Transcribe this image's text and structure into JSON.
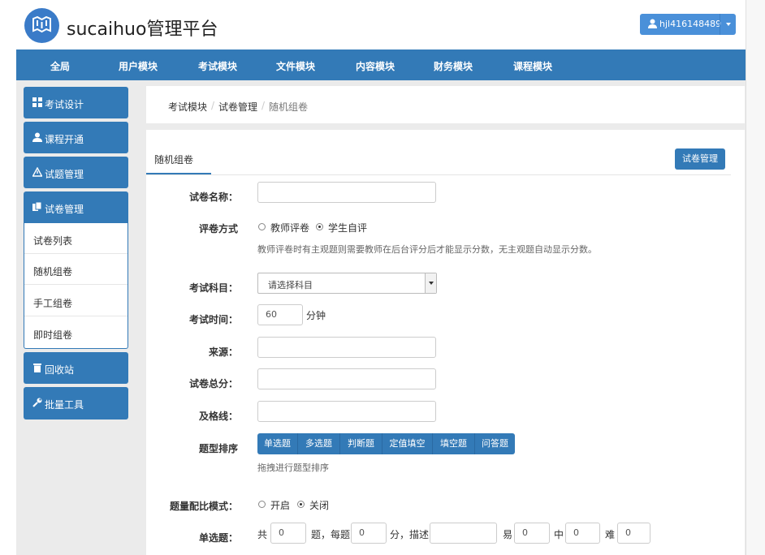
{
  "header": {
    "brand": "sucaihuo管理平台",
    "user": "hjl416148489"
  },
  "topnav": [
    "全局",
    "用户模块",
    "考试模块",
    "文件模块",
    "内容模块",
    "财务模块",
    "课程模块"
  ],
  "sidebar": {
    "exam_design": "考试设计",
    "course_open": "课程开通",
    "question_mgmt": "试题管理",
    "paper_mgmt": "试卷管理",
    "sub_items": [
      "试卷列表",
      "随机组卷",
      "手工组卷",
      "即时组卷"
    ],
    "recycle": "回收站",
    "batch_tools": "批量工具"
  },
  "breadcrumb": [
    "考试模块",
    "试卷管理",
    "随机组卷"
  ],
  "panel": {
    "tab": "随机组卷",
    "paper_mgmt_button": "试卷管理",
    "form": {
      "paper_name_label": "试卷名称：",
      "grading_label": "评卷方式",
      "grading_options": [
        "教师评卷",
        "学生自评"
      ],
      "grading_selected": "学生自评",
      "grading_hint": "教师评卷时有主观题则需要教师在后台评分后才能显示分数，无主观题自动显示分数。",
      "subject_label": "考试科目：",
      "subject_placeholder": "请选择科目",
      "time_label": "考试时间：",
      "time_value": "60",
      "time_unit": "分钟",
      "source_label": "来源：",
      "total_label": "试卷总分：",
      "pass_label": "及格线：",
      "qorder_label": "题型排序",
      "qtypes": [
        "单选题",
        "多选题",
        "判断题",
        "定值填空",
        "填空题",
        "问答题"
      ],
      "qorder_hint": "拖拽进行题型排序",
      "ratio_label": "题量配比模式：",
      "ratio_options": [
        "开启",
        "关闭"
      ],
      "ratio_selected": "关闭",
      "single_label": "单选题：",
      "single_total_prefix": "共",
      "single_count": "0",
      "single_mid": "题，每题",
      "single_score": "0",
      "single_desc": "分，描述",
      "easy_label": "易",
      "easy_val": "0",
      "mid_label": "中",
      "mid_val": "0",
      "hard_label": "难",
      "hard_val": "0"
    }
  },
  "colors": {
    "primary": "#337ab7",
    "user_button": "#4a90d9"
  }
}
